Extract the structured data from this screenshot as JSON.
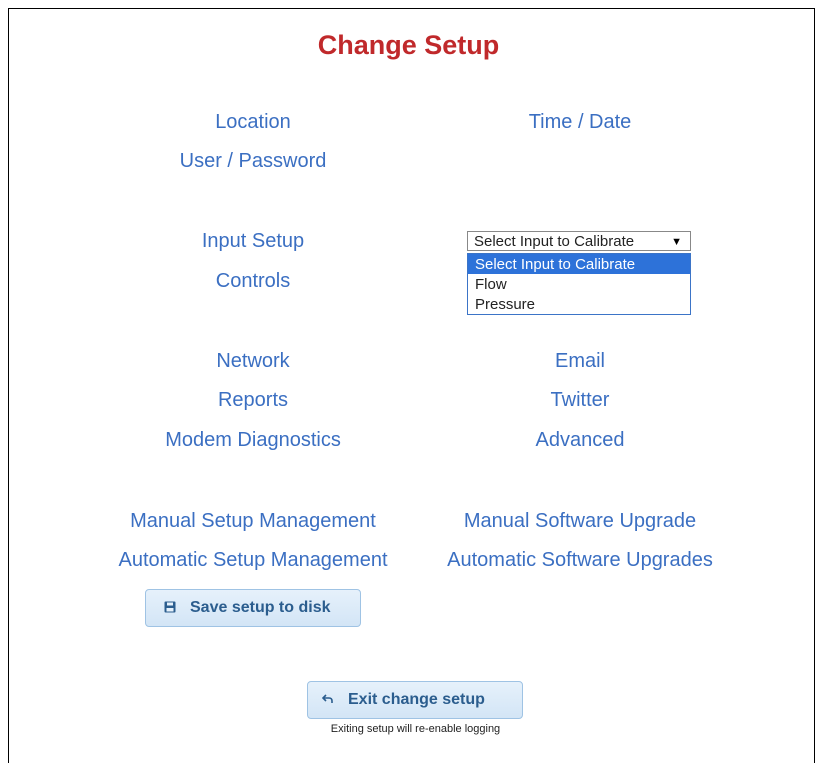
{
  "title": "Change Setup",
  "links": {
    "location": "Location",
    "time_date": "Time / Date",
    "user_password": "User / Password",
    "input_setup": "Input Setup",
    "controls": "Controls",
    "network": "Network",
    "email": "Email",
    "reports": "Reports",
    "twitter": "Twitter",
    "modem_diagnostics": "Modem Diagnostics",
    "advanced": "Advanced",
    "manual_setup_management": "Manual Setup Management",
    "manual_software_upgrade": "Manual Software Upgrade",
    "automatic_setup_management": "Automatic Setup Management",
    "automatic_software_upgrades": "Automatic Software Upgrades"
  },
  "calibrate_select": {
    "selected": "Select Input to Calibrate",
    "options": [
      "Select Input to Calibrate",
      "Flow",
      "Pressure"
    ]
  },
  "buttons": {
    "save_label": "Save setup to disk",
    "save_icon": "floppy-disk-icon",
    "exit_label": "Exit change setup",
    "exit_icon": "undo-arrow-icon"
  },
  "exit_hint": "Exiting setup will re-enable logging",
  "colors": {
    "title": "#c0292b",
    "link": "#3b6fc2",
    "button_text": "#2b5d8e",
    "selected_option_bg": "#2d72d9"
  }
}
